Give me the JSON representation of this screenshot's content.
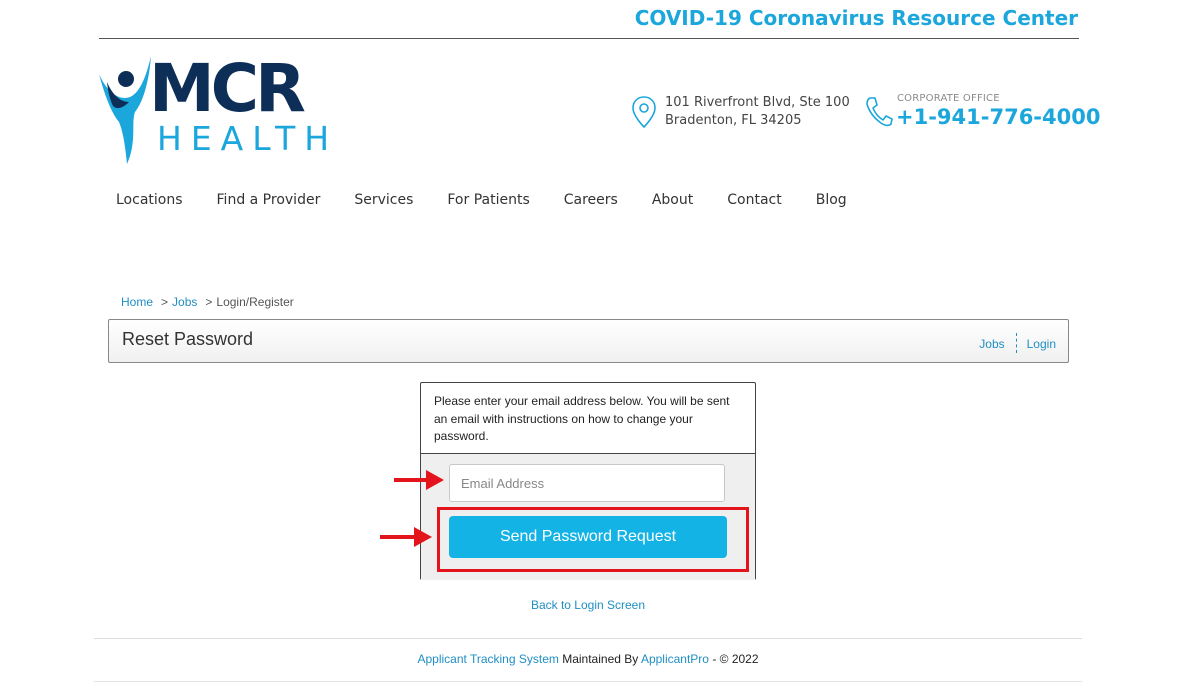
{
  "banner": {
    "covid_link": "COVID-19 Coronavirus Resource Center"
  },
  "logo": {
    "line1": "MCR",
    "line2": "HEALTH"
  },
  "contact": {
    "address_line1": "101 Riverfront Blvd, Ste 100",
    "address_line2": "Bradenton, FL 34205",
    "office_label": "CORPORATE OFFICE",
    "phone": "+1-941-776-4000"
  },
  "nav": [
    "Locations",
    "Find a Provider",
    "Services",
    "For Patients",
    "Careers",
    "About",
    "Contact",
    "Blog"
  ],
  "breadcrumb": {
    "home": "Home",
    "jobs": "Jobs",
    "current": "Login/Register",
    "separator": ">"
  },
  "titlebar": {
    "title": "Reset Password",
    "link_jobs": "Jobs",
    "link_login": "Login"
  },
  "reset_form": {
    "instructions": "Please enter your email address below. You will be sent an email with instructions on how to change your password.",
    "email_placeholder": "Email Address",
    "email_value": "",
    "submit_label": "Send Password Request",
    "back_link": "Back to Login Screen"
  },
  "footer": {
    "ats_link": "Applicant Tracking System",
    "maintained_by": " Maintained By ",
    "vendor_link": "ApplicantPro",
    "copyright": " - © 2022"
  },
  "colors": {
    "brand_blue": "#1ba6dc",
    "navy": "#0c2e57",
    "annotation_red": "#e3141b",
    "button_blue": "#13b3e6"
  },
  "icons": [
    "location-pin-icon",
    "phone-icon",
    "logo-figure-icon",
    "arrow-annotation-icon"
  ]
}
